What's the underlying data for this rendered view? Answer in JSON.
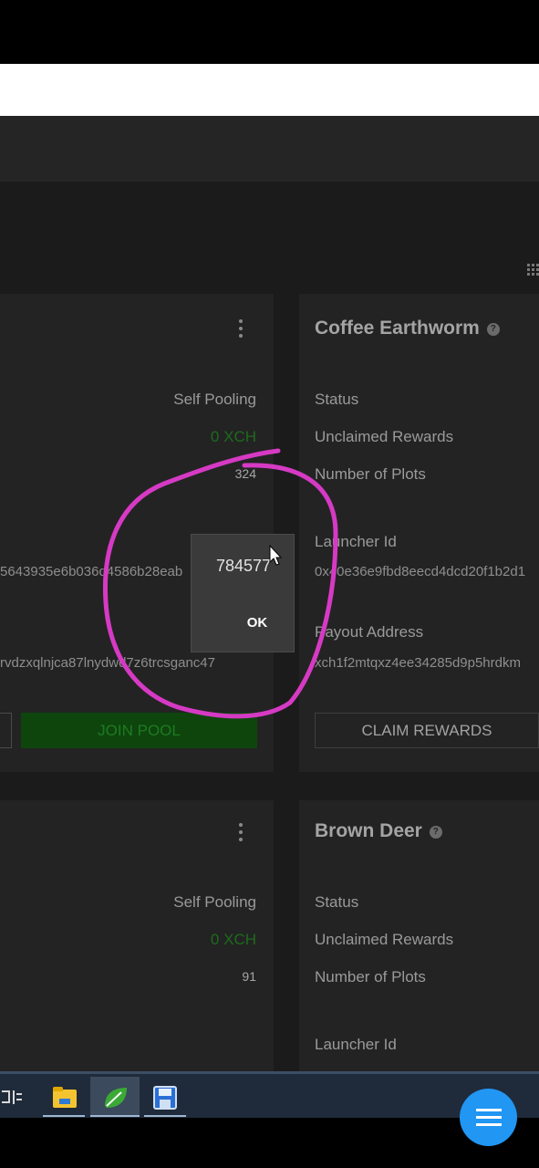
{
  "left_card_1": {
    "self_pooling": "Self Pooling",
    "unclaimed_value": "0 XCH",
    "plots_value": "324",
    "launcher_id_partial": "5643935e6b036d4586b28eab",
    "payout_partial": "rvdzxqlnjca87lnydwd7z6trcsganc47",
    "join_pool": "JOIN POOL"
  },
  "right_card_1": {
    "title": "Coffee Earthworm",
    "status_label": "Status",
    "unclaimed_label": "Unclaimed Rewards",
    "plots_label": "Number of Plots",
    "launcher_id_label": "Launcher Id",
    "launcher_id_value": "0x40e36e9fbd8eecd4dcd20f1b2d1",
    "payout_label": "Payout Address",
    "payout_value": "xch1f2mtqxz4ee34285d9p5hrdkm",
    "claim_rewards": "CLAIM REWARDS"
  },
  "left_card_2": {
    "self_pooling": "Self Pooling",
    "unclaimed_value": "0 XCH",
    "plots_value": "91"
  },
  "right_card_2": {
    "title": "Brown Deer",
    "status_label": "Status",
    "unclaimed_label": "Unclaimed Rewards",
    "plots_label": "Number of Plots",
    "launcher_id_label": "Launcher Id"
  },
  "dialog": {
    "message": "784577",
    "ok": "OK"
  },
  "colors": {
    "annotation": "#d63ac4",
    "fab": "#2196f3",
    "join_pool_bg": "#0d450d"
  },
  "icons": [
    "grid-icon",
    "more-vert-icon",
    "help-icon",
    "file-explorer-icon",
    "leaf-app-icon",
    "save-app-icon",
    "menu-icon"
  ]
}
